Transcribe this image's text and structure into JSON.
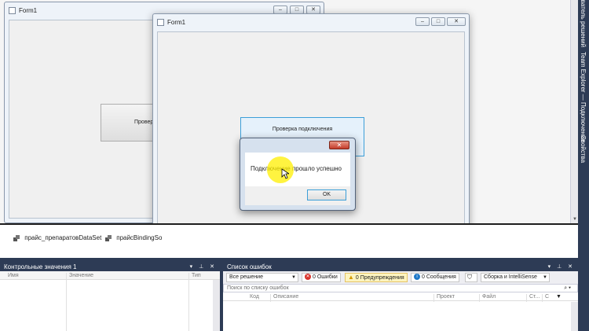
{
  "back_form": {
    "title": "Form1",
    "button_label": "Проверка подключения",
    "button_label_visible": "Проверка"
  },
  "front_form": {
    "title": "Form1",
    "button_label": "Проверка подключения"
  },
  "message_box": {
    "text": "Подключение прошло успешно",
    "ok_label": "OK",
    "close_glyph": "✕"
  },
  "tray": {
    "items": [
      "прайс_препаратовDataSet",
      "прайсBindingSo"
    ]
  },
  "right_tabs": [
    "Обозреватель решений",
    "Team Explorer — Подключение",
    "Свойства"
  ],
  "watch_panel": {
    "title": "Контрольные значения 1",
    "columns": [
      "Имя",
      "Значение",
      "Тип"
    ]
  },
  "error_panel": {
    "title": "Список ошибок",
    "scope_select": "Все решение",
    "errors_label": "0 Ошибки",
    "warnings_label": "0 Предупреждения",
    "messages_label": "0 Сообщения",
    "build_select": "Сборка и IntelliSense",
    "search_placeholder": "Поиск по списку ошибок",
    "columns": [
      "Код",
      "Описание",
      "Проект",
      "Файл",
      "Ст...",
      "С"
    ]
  },
  "colors": {
    "vs_dark": "#2d3b55",
    "error_red": "#d9332b",
    "warning_yellow": "#f0c24b",
    "info_blue": "#1e78c8",
    "cursor_highlight": "#ffef00"
  }
}
